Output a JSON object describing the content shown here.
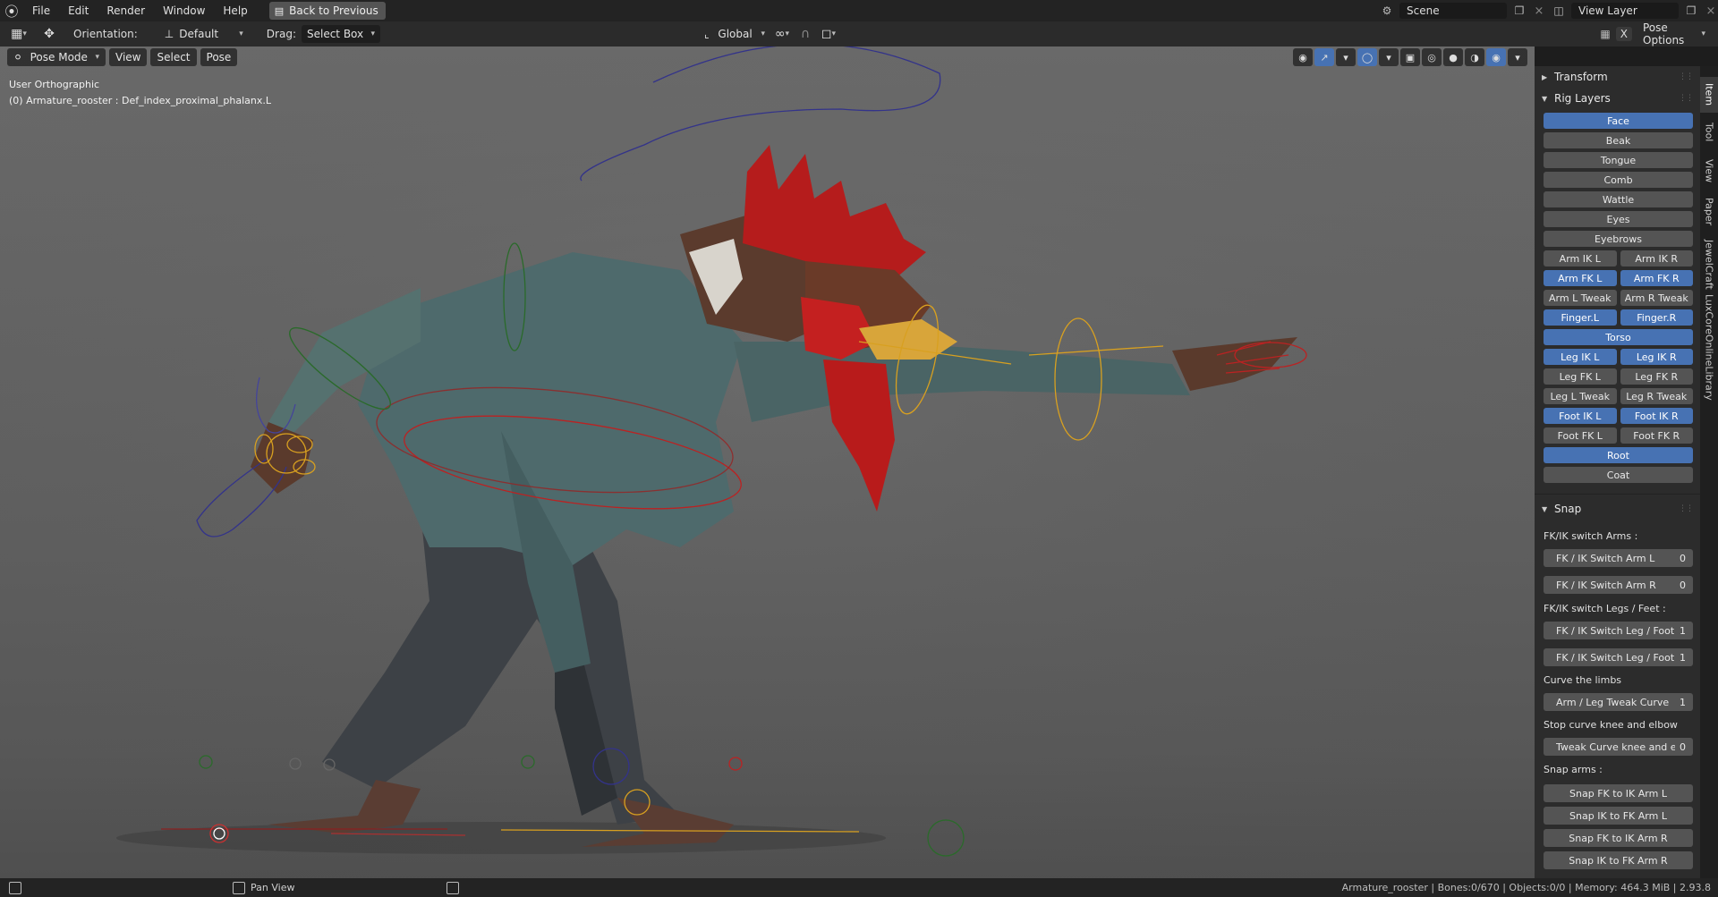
{
  "menu": {
    "items": [
      "File",
      "Edit",
      "Render",
      "Window",
      "Help"
    ],
    "back_button": "Back to Previous"
  },
  "topright": {
    "scene": "Scene",
    "view_layer": "View Layer"
  },
  "toolheader": {
    "orientation_label": "Orientation:",
    "orientation_value": "Default",
    "drag_label": "Drag:",
    "drag_value": "Select Box",
    "transform_space": "Global",
    "pose_options": "Pose Options"
  },
  "viewport": {
    "mode": "Pose Mode",
    "menus": [
      "View",
      "Select",
      "Pose"
    ],
    "info_line1": "User Orthographic",
    "info_line2": "(0) Armature_rooster : Def_index_proximal_phalanx.L"
  },
  "sidebar": {
    "tabs": [
      "Item",
      "Tool",
      "View",
      "Paper",
      "JewelCraft",
      "LuxCoreOnlineLibrary"
    ],
    "transform_title": "Transform",
    "rig_layers_title": "Rig Layers",
    "rig_layers": [
      [
        {
          "label": "Face",
          "on": true
        }
      ],
      [
        {
          "label": "Beak",
          "on": false
        }
      ],
      [
        {
          "label": "Tongue",
          "on": false
        }
      ],
      [
        {
          "label": "Comb",
          "on": false
        }
      ],
      [
        {
          "label": "Wattle",
          "on": false
        }
      ],
      [
        {
          "label": "Eyes",
          "on": false
        }
      ],
      [
        {
          "label": "Eyebrows",
          "on": false
        }
      ],
      [
        {
          "label": "Arm IK L",
          "on": false
        },
        {
          "label": "Arm IK R",
          "on": false
        }
      ],
      [
        {
          "label": "Arm FK L",
          "on": true
        },
        {
          "label": "Arm FK R",
          "on": true
        }
      ],
      [
        {
          "label": "Arm L Tweak",
          "on": false
        },
        {
          "label": "Arm R Tweak",
          "on": false
        }
      ],
      [
        {
          "label": "Finger.L",
          "on": true
        },
        {
          "label": "Finger.R",
          "on": true
        }
      ],
      [
        {
          "label": "Torso",
          "on": true
        }
      ],
      [
        {
          "label": "Leg IK L",
          "on": true
        },
        {
          "label": "Leg IK R",
          "on": true
        }
      ],
      [
        {
          "label": "Leg FK L",
          "on": false
        },
        {
          "label": "Leg FK R",
          "on": false
        }
      ],
      [
        {
          "label": "Leg L Tweak",
          "on": false
        },
        {
          "label": "Leg R Tweak",
          "on": false
        }
      ],
      [
        {
          "label": "Foot IK L",
          "on": true
        },
        {
          "label": "Foot IK R",
          "on": true
        }
      ],
      [
        {
          "label": "Foot FK L",
          "on": false
        },
        {
          "label": "Foot FK R",
          "on": false
        }
      ],
      [
        {
          "label": "Root",
          "on": true
        }
      ],
      [
        {
          "label": "Coat",
          "on": false
        }
      ]
    ],
    "snap_title": "Snap",
    "snap": {
      "fkik_arms_label": "FK/IK switch Arms :",
      "arm_l": {
        "label": "FK / IK Switch Arm L",
        "value": "0"
      },
      "arm_r": {
        "label": "FK / IK Switch Arm R",
        "value": "0"
      },
      "fkik_legs_label": "FK/IK switch Legs / Feet :",
      "leg_1": {
        "label": "FK / IK Switch Leg / Foot",
        "value": "1"
      },
      "leg_2": {
        "label": "FK / IK Switch Leg / Foot",
        "value": "1"
      },
      "curve_label": "Curve the limbs",
      "curve": {
        "label": "Arm / Leg Tweak Curve",
        "value": "1"
      },
      "stop_label": "Stop curve knee and elbow",
      "stop": {
        "label": "Tweak Curve knee and el",
        "value": "0"
      },
      "snap_arms_label": "Snap arms :",
      "ops": [
        "Snap FK to IK Arm L",
        "Snap IK to FK Arm L",
        "Snap FK to IK Arm R",
        "Snap IK to FK Arm R"
      ]
    }
  },
  "statusbar": {
    "pan_view": "Pan View",
    "stats": "Armature_rooster | Bones:0/670 | Objects:0/0 | Memory: 464.3 MiB | 2.93.8"
  },
  "colors": {
    "accent": "#4772b3",
    "button": "#545454",
    "panel": "#2c2c2c",
    "header": "#232323"
  }
}
